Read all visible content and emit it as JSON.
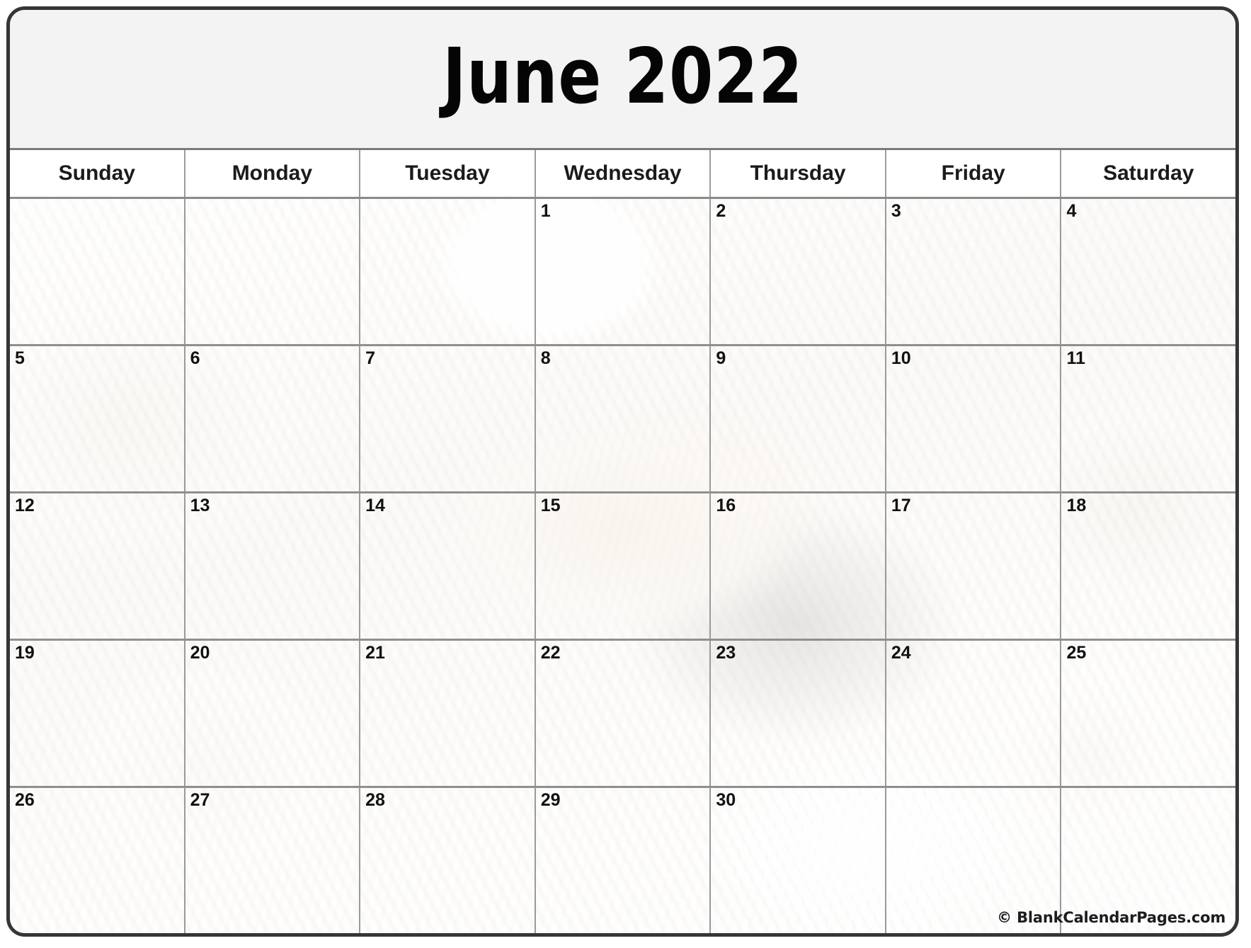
{
  "calendar": {
    "title": "June 2022",
    "month": "June",
    "year": "2022",
    "weekday_headers": [
      "Sunday",
      "Monday",
      "Tuesday",
      "Wednesday",
      "Thursday",
      "Friday",
      "Saturday"
    ],
    "weeks": [
      [
        "",
        "",
        "",
        "1",
        "2",
        "3",
        "4"
      ],
      [
        "5",
        "6",
        "7",
        "8",
        "9",
        "10",
        "11"
      ],
      [
        "12",
        "13",
        "14",
        "15",
        "16",
        "17",
        "18"
      ],
      [
        "19",
        "20",
        "21",
        "22",
        "23",
        "24",
        "25"
      ],
      [
        "26",
        "27",
        "28",
        "29",
        "30",
        "",
        ""
      ]
    ],
    "watermark": "© BlankCalendarPages.com",
    "theme": {
      "border_color": "#363636",
      "title_bg": "#f3f3f3",
      "header_bg": "#ffffff",
      "grid_line_color": "#9a9a9a",
      "text_color": "#111111",
      "background_photo": "seashells-on-sand"
    }
  }
}
